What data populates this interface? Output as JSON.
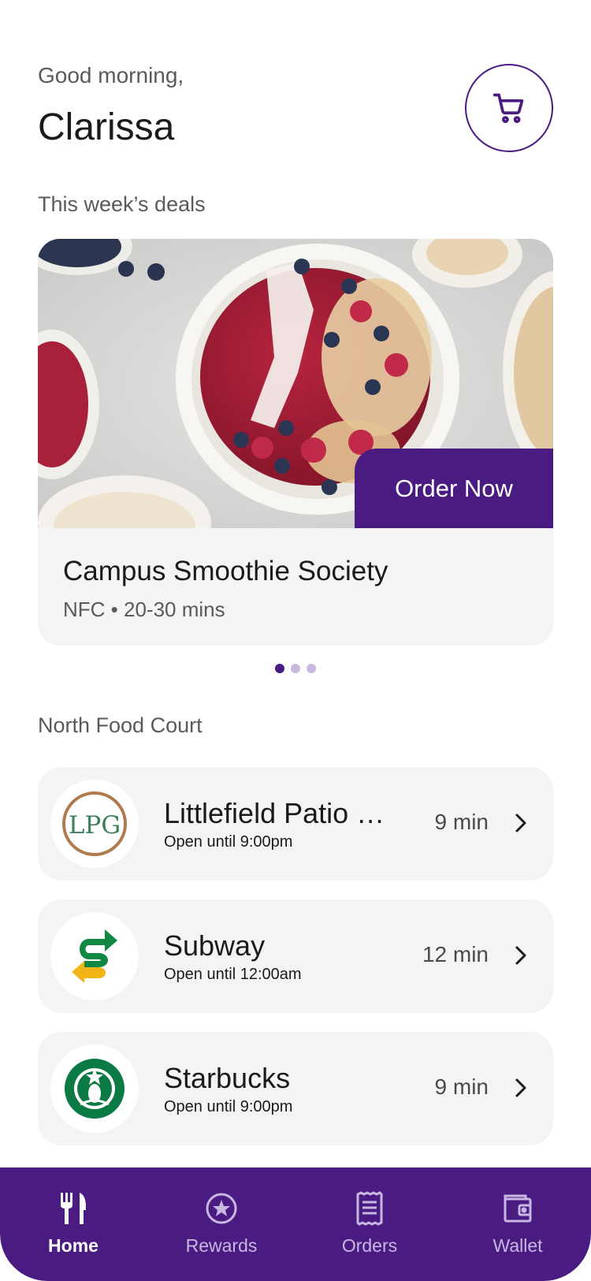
{
  "header": {
    "greeting": "Good morning,",
    "username": "Clarissa"
  },
  "deals": {
    "section_title": "This week’s deals",
    "card": {
      "name": "Campus Smoothie Society",
      "meta": "NFC • 20-30 mins",
      "cta_label": "Order Now"
    },
    "pagination": {
      "count": 3,
      "active": 1
    }
  },
  "food_court": {
    "section_title": "North Food Court",
    "restaurants": [
      {
        "name": "Littlefield Patio Café",
        "hours": "Open until 9:00pm",
        "time": "9 min",
        "logo": "lpg-logo-icon"
      },
      {
        "name": "Subway",
        "hours": "Open until 12:00am",
        "time": "12 min",
        "logo": "subway-logo-icon"
      },
      {
        "name": "Starbucks",
        "hours": "Open until 9:00pm",
        "time": "9 min",
        "logo": "starbucks-logo-icon"
      }
    ]
  },
  "tabbar": {
    "tabs": [
      {
        "label": "Home",
        "icon": "fork-knife-icon",
        "active": true
      },
      {
        "label": "Rewards",
        "icon": "star-badge-icon",
        "active": false
      },
      {
        "label": "Orders",
        "icon": "receipt-icon",
        "active": false
      },
      {
        "label": "Wallet",
        "icon": "wallet-icon",
        "active": false
      }
    ]
  },
  "colors": {
    "brand": "#4a1c82",
    "card_bg": "#f4f4f4",
    "text_secondary": "#5a5a5a"
  }
}
